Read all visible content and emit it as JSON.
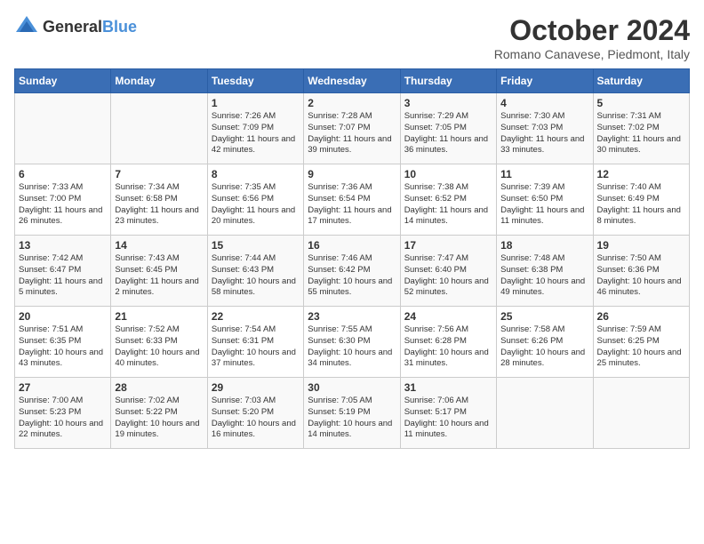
{
  "logo": {
    "text_general": "General",
    "text_blue": "Blue"
  },
  "title": "October 2024",
  "subtitle": "Romano Canavese, Piedmont, Italy",
  "days_of_week": [
    "Sunday",
    "Monday",
    "Tuesday",
    "Wednesday",
    "Thursday",
    "Friday",
    "Saturday"
  ],
  "weeks": [
    [
      {
        "day": "",
        "info": ""
      },
      {
        "day": "",
        "info": ""
      },
      {
        "day": "1",
        "info": "Sunrise: 7:26 AM\nSunset: 7:09 PM\nDaylight: 11 hours\nand 42 minutes."
      },
      {
        "day": "2",
        "info": "Sunrise: 7:28 AM\nSunset: 7:07 PM\nDaylight: 11 hours\nand 39 minutes."
      },
      {
        "day": "3",
        "info": "Sunrise: 7:29 AM\nSunset: 7:05 PM\nDaylight: 11 hours\nand 36 minutes."
      },
      {
        "day": "4",
        "info": "Sunrise: 7:30 AM\nSunset: 7:03 PM\nDaylight: 11 hours\nand 33 minutes."
      },
      {
        "day": "5",
        "info": "Sunrise: 7:31 AM\nSunset: 7:02 PM\nDaylight: 11 hours\nand 30 minutes."
      }
    ],
    [
      {
        "day": "6",
        "info": "Sunrise: 7:33 AM\nSunset: 7:00 PM\nDaylight: 11 hours\nand 26 minutes."
      },
      {
        "day": "7",
        "info": "Sunrise: 7:34 AM\nSunset: 6:58 PM\nDaylight: 11 hours\nand 23 minutes."
      },
      {
        "day": "8",
        "info": "Sunrise: 7:35 AM\nSunset: 6:56 PM\nDaylight: 11 hours\nand 20 minutes."
      },
      {
        "day": "9",
        "info": "Sunrise: 7:36 AM\nSunset: 6:54 PM\nDaylight: 11 hours\nand 17 minutes."
      },
      {
        "day": "10",
        "info": "Sunrise: 7:38 AM\nSunset: 6:52 PM\nDaylight: 11 hours\nand 14 minutes."
      },
      {
        "day": "11",
        "info": "Sunrise: 7:39 AM\nSunset: 6:50 PM\nDaylight: 11 hours\nand 11 minutes."
      },
      {
        "day": "12",
        "info": "Sunrise: 7:40 AM\nSunset: 6:49 PM\nDaylight: 11 hours\nand 8 minutes."
      }
    ],
    [
      {
        "day": "13",
        "info": "Sunrise: 7:42 AM\nSunset: 6:47 PM\nDaylight: 11 hours\nand 5 minutes."
      },
      {
        "day": "14",
        "info": "Sunrise: 7:43 AM\nSunset: 6:45 PM\nDaylight: 11 hours\nand 2 minutes."
      },
      {
        "day": "15",
        "info": "Sunrise: 7:44 AM\nSunset: 6:43 PM\nDaylight: 10 hours\nand 58 minutes."
      },
      {
        "day": "16",
        "info": "Sunrise: 7:46 AM\nSunset: 6:42 PM\nDaylight: 10 hours\nand 55 minutes."
      },
      {
        "day": "17",
        "info": "Sunrise: 7:47 AM\nSunset: 6:40 PM\nDaylight: 10 hours\nand 52 minutes."
      },
      {
        "day": "18",
        "info": "Sunrise: 7:48 AM\nSunset: 6:38 PM\nDaylight: 10 hours\nand 49 minutes."
      },
      {
        "day": "19",
        "info": "Sunrise: 7:50 AM\nSunset: 6:36 PM\nDaylight: 10 hours\nand 46 minutes."
      }
    ],
    [
      {
        "day": "20",
        "info": "Sunrise: 7:51 AM\nSunset: 6:35 PM\nDaylight: 10 hours\nand 43 minutes."
      },
      {
        "day": "21",
        "info": "Sunrise: 7:52 AM\nSunset: 6:33 PM\nDaylight: 10 hours\nand 40 minutes."
      },
      {
        "day": "22",
        "info": "Sunrise: 7:54 AM\nSunset: 6:31 PM\nDaylight: 10 hours\nand 37 minutes."
      },
      {
        "day": "23",
        "info": "Sunrise: 7:55 AM\nSunset: 6:30 PM\nDaylight: 10 hours\nand 34 minutes."
      },
      {
        "day": "24",
        "info": "Sunrise: 7:56 AM\nSunset: 6:28 PM\nDaylight: 10 hours\nand 31 minutes."
      },
      {
        "day": "25",
        "info": "Sunrise: 7:58 AM\nSunset: 6:26 PM\nDaylight: 10 hours\nand 28 minutes."
      },
      {
        "day": "26",
        "info": "Sunrise: 7:59 AM\nSunset: 6:25 PM\nDaylight: 10 hours\nand 25 minutes."
      }
    ],
    [
      {
        "day": "27",
        "info": "Sunrise: 7:00 AM\nSunset: 5:23 PM\nDaylight: 10 hours\nand 22 minutes."
      },
      {
        "day": "28",
        "info": "Sunrise: 7:02 AM\nSunset: 5:22 PM\nDaylight: 10 hours\nand 19 minutes."
      },
      {
        "day": "29",
        "info": "Sunrise: 7:03 AM\nSunset: 5:20 PM\nDaylight: 10 hours\nand 16 minutes."
      },
      {
        "day": "30",
        "info": "Sunrise: 7:05 AM\nSunset: 5:19 PM\nDaylight: 10 hours\nand 14 minutes."
      },
      {
        "day": "31",
        "info": "Sunrise: 7:06 AM\nSunset: 5:17 PM\nDaylight: 10 hours\nand 11 minutes."
      },
      {
        "day": "",
        "info": ""
      },
      {
        "day": "",
        "info": ""
      }
    ]
  ]
}
